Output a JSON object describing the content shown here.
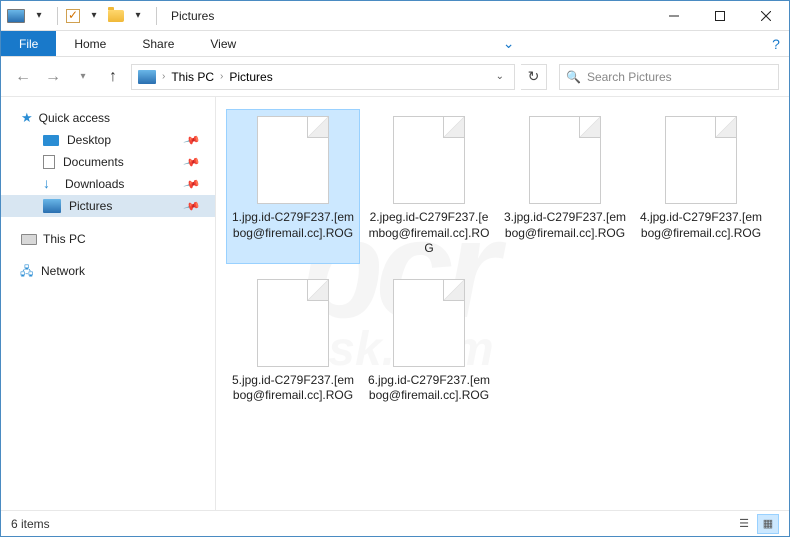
{
  "titlebar": {
    "separator": "|",
    "title": "Pictures"
  },
  "ribbon": {
    "file": "File",
    "tabs": [
      "Home",
      "Share",
      "View"
    ]
  },
  "nav": {
    "breadcrumbs": [
      "This PC",
      "Pictures"
    ],
    "search_placeholder": "Search Pictures"
  },
  "sidebar": {
    "quick_access": "Quick access",
    "items": [
      {
        "label": "Desktop",
        "icon": "desktop",
        "pinned": true
      },
      {
        "label": "Documents",
        "icon": "doc",
        "pinned": true
      },
      {
        "label": "Downloads",
        "icon": "down",
        "pinned": true
      },
      {
        "label": "Pictures",
        "icon": "pictures",
        "pinned": true,
        "selected": true
      }
    ],
    "this_pc": "This PC",
    "network": "Network"
  },
  "files": [
    {
      "name": "1.jpg.id-C279F237.[embog@firemail.cc].ROG",
      "selected": true
    },
    {
      "name": "2.jpeg.id-C279F237.[embog@firemail.cc].ROG"
    },
    {
      "name": "3.jpg.id-C279F237.[embog@firemail.cc].ROG"
    },
    {
      "name": "4.jpg.id-C279F237.[embog@firemail.cc].ROG"
    },
    {
      "name": "5.jpg.id-C279F237.[embog@firemail.cc].ROG"
    },
    {
      "name": "6.jpg.id-C279F237.[embog@firemail.cc].ROG"
    }
  ],
  "status": {
    "count": "6 items"
  },
  "watermark": {
    "main": "pcr",
    "sub": "risk.com"
  }
}
